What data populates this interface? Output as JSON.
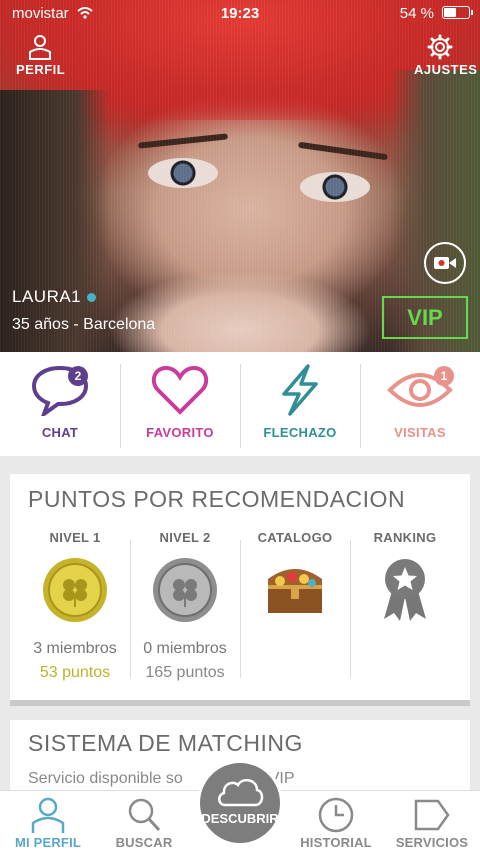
{
  "status_bar": {
    "carrier": "movistar",
    "time": "19:23",
    "battery": "54 %",
    "battery_level": 0.54
  },
  "header": {
    "profile_label": "PERFIL",
    "settings_label": "AJUSTES"
  },
  "profile": {
    "name": "LAURA1",
    "subtitle": "35 años - Barcelona",
    "vip_label": "VIP",
    "online_color": "#4ab1c7"
  },
  "actions": [
    {
      "label": "CHAT",
      "badge": "2",
      "color": "#5d3f8e",
      "icon": "chat-bubble-icon"
    },
    {
      "label": "FAVORITO",
      "badge": "",
      "color": "#c93c9b",
      "icon": "heart-icon"
    },
    {
      "label": "FLECHAZO",
      "badge": "",
      "color": "#2f8f94",
      "icon": "lightning-icon"
    },
    {
      "label": "VISITAS",
      "badge": "1",
      "color": "#e9918b",
      "icon": "eye-icon"
    }
  ],
  "points": {
    "title": "PUNTOS POR RECOMENDACION",
    "columns": [
      {
        "title": "NIVEL 1",
        "line1": "3 miembros",
        "line2": "53 puntos",
        "line2_color": "#b5b52c",
        "icon": "gold-coin-icon"
      },
      {
        "title": "NIVEL 2",
        "line1": "0 miembros",
        "line2": "165 puntos",
        "line2_color": "#888888",
        "icon": "silver-coin-icon"
      },
      {
        "title": "CATALOGO",
        "line1": "",
        "line2": "",
        "icon": "treasure-chest-icon"
      },
      {
        "title": "RANKING",
        "line1": "",
        "line2": "",
        "icon": "ribbon-badge-icon"
      }
    ]
  },
  "matching": {
    "title": "SISTEMA DE MATCHING",
    "subtitle": "Servicio disponible so",
    "subtitle_tail": "VIP"
  },
  "tabbar": {
    "tabs": [
      {
        "label": "MI PERFIL",
        "icon": "user-icon",
        "active": true
      },
      {
        "label": "BUSCAR",
        "icon": "search-icon",
        "active": false
      },
      {
        "label": "",
        "icon": "",
        "active": false
      },
      {
        "label": "HISTORIAL",
        "icon": "clock-icon",
        "active": false
      },
      {
        "label": "SERVICIOS",
        "icon": "services-icon",
        "active": false
      }
    ],
    "discover_label": "DESCUBRIR",
    "active_color": "#5aa7c9"
  }
}
